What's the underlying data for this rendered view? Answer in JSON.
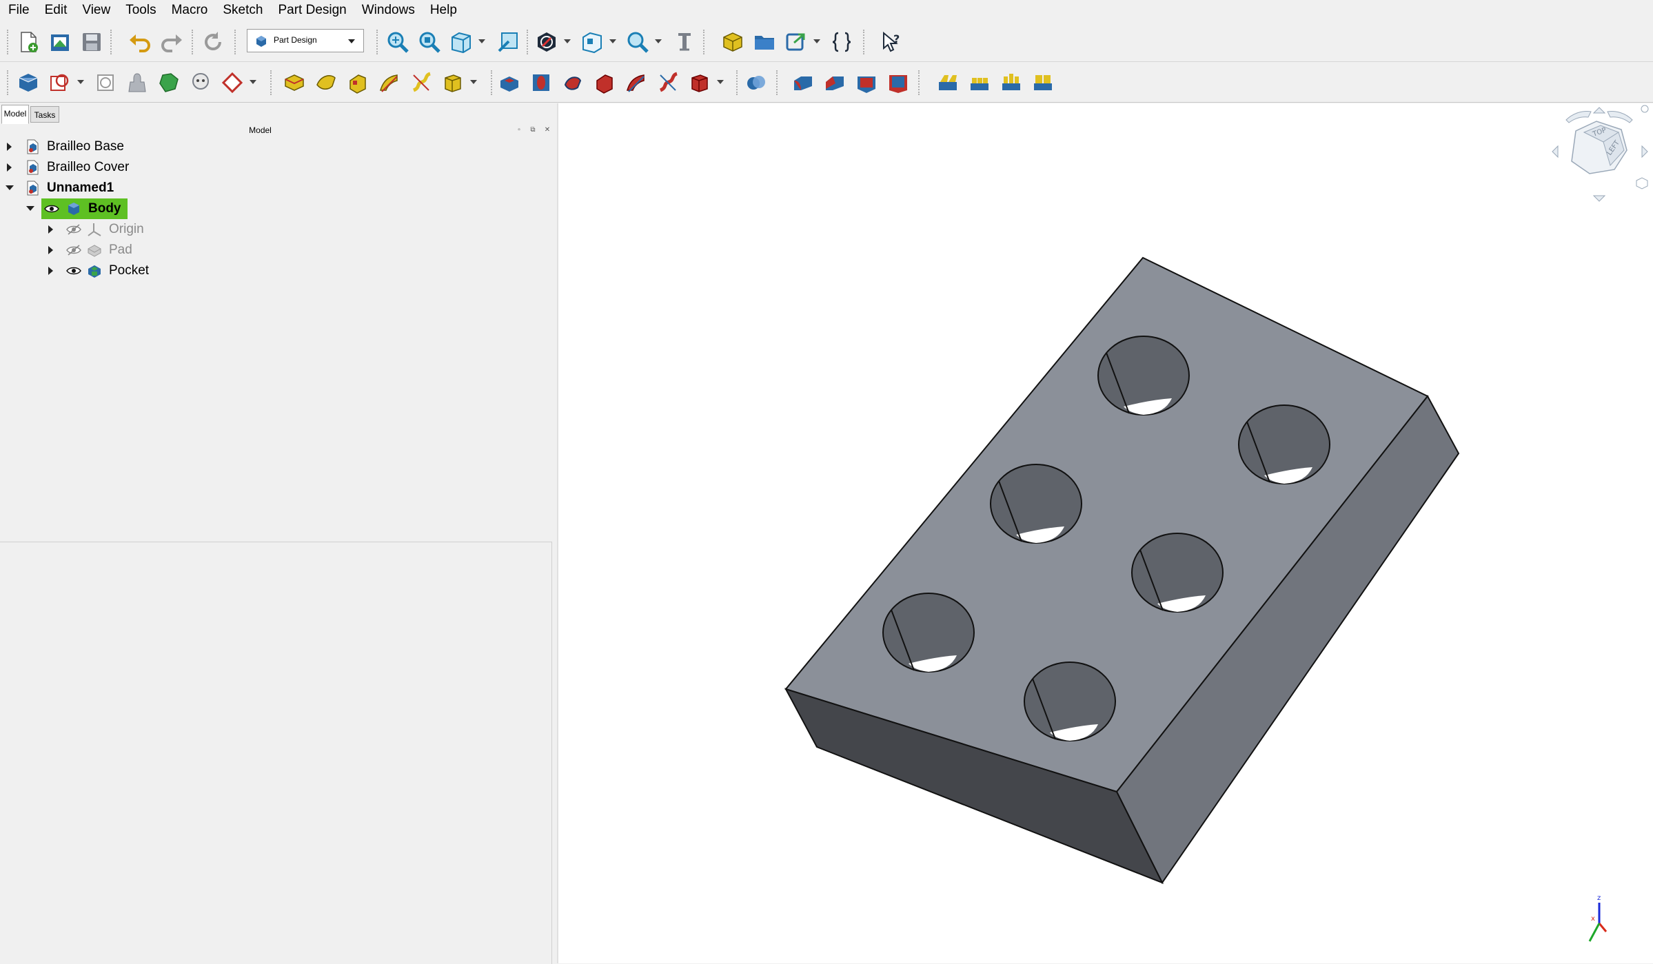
{
  "menubar": {
    "items": [
      "File",
      "Edit",
      "View",
      "Tools",
      "Macro",
      "Sketch",
      "Part Design",
      "Windows",
      "Help"
    ]
  },
  "toolbar": {
    "workbench_selector": "Part Design"
  },
  "combo_view": {
    "tabs": [
      "Model",
      "Tasks"
    ],
    "header_title": "Model",
    "tree": [
      {
        "label": "Brailleo Base",
        "expanded": false,
        "level": 0
      },
      {
        "label": "Brailleo Cover",
        "expanded": false,
        "level": 0
      },
      {
        "label": "Unnamed1",
        "expanded": true,
        "level": 0,
        "bold": true
      },
      {
        "label": "Body",
        "expanded": true,
        "level": 1,
        "bold": true,
        "active": true,
        "visible": true
      },
      {
        "label": "Origin",
        "expanded": false,
        "level": 2,
        "visible": false
      },
      {
        "label": "Pad",
        "expanded": false,
        "level": 2,
        "visible": false
      },
      {
        "label": "Pocket",
        "expanded": false,
        "level": 2,
        "visible": true
      }
    ]
  },
  "viewport": {
    "navcube_faces": [
      "TOP",
      "LEFT"
    ],
    "axis_labels": [
      "z",
      "x"
    ]
  },
  "colors": {
    "active_body_highlight": "#5ec023",
    "model_top_face": "#8b9099",
    "model_front_face": "#71757d",
    "model_side_face": "#44464b"
  }
}
